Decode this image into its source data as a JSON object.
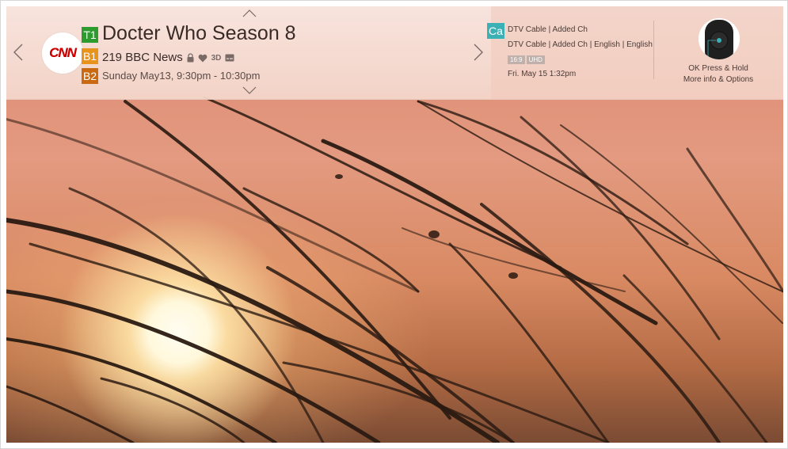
{
  "program": {
    "title": "Docter Who Season 8",
    "channel": "219 BBC News",
    "schedule": "Sunday May13, 9:30pm - 10:30pm",
    "badges": {
      "t1": "T1",
      "b1": "B1",
      "b2": "B2"
    },
    "logo_text": "CNN",
    "channel_icons": [
      "lock-icon",
      "heart-icon",
      "3d-icon",
      "caption-icon"
    ],
    "icon_3d_text": "3D"
  },
  "source": {
    "badge": "Ca",
    "line1": "DTV Cable | Added Ch",
    "line2": "DTV Cable | Added Ch | English | English",
    "tags": [
      "16:9",
      "UHD"
    ],
    "datetime": "Fri. May 15 1:32pm"
  },
  "remote_hint": {
    "line1": "OK Press & Hold",
    "line2": "More info & Options"
  },
  "colors": {
    "t1": "#2e9b2e",
    "b1": "#e8931c",
    "b2": "#c96a12",
    "ca": "#3bb1b6",
    "logo": "#cc0000"
  }
}
